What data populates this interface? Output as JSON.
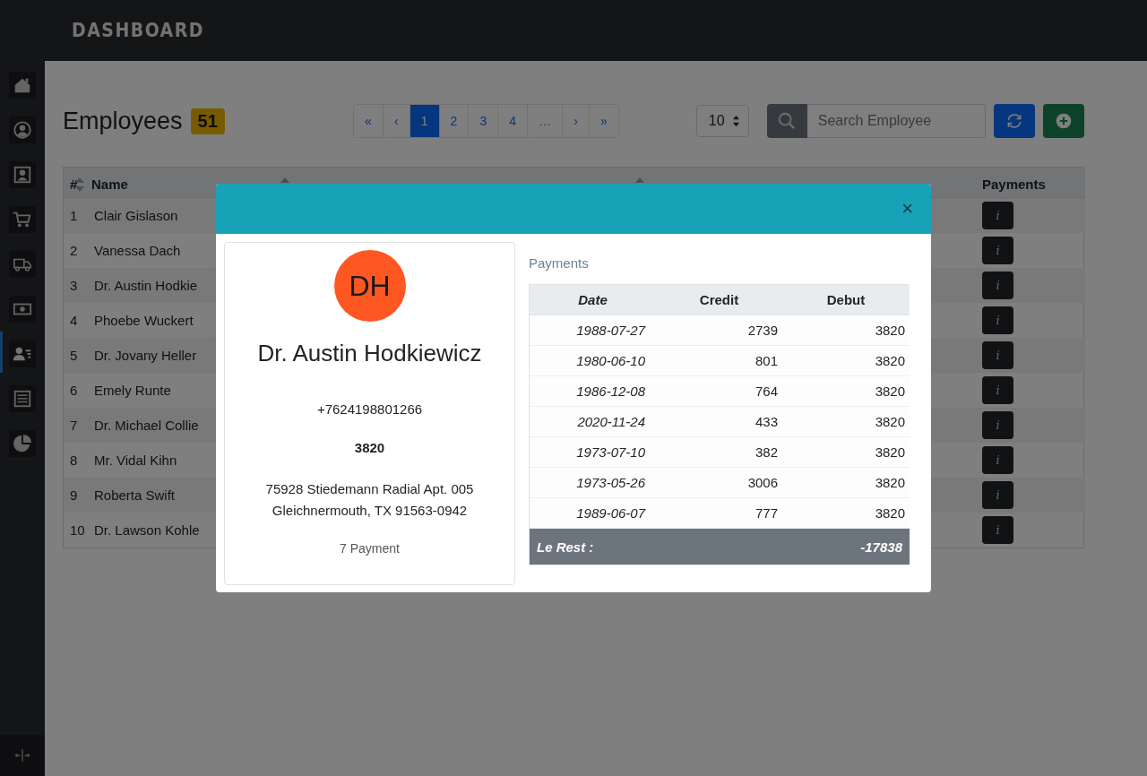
{
  "app": {
    "title": "DASHBOARD"
  },
  "sidebar": {
    "items": [
      {
        "selected": false
      },
      {
        "selected": false
      },
      {
        "selected": false
      },
      {
        "selected": false
      },
      {
        "selected": false
      },
      {
        "selected": false
      },
      {
        "selected": true
      },
      {
        "selected": false
      },
      {
        "selected": false
      }
    ]
  },
  "toolbar": {
    "heading": "Employees",
    "count": "51",
    "pagination": [
      {
        "label": "«",
        "selected": false
      },
      {
        "label": "‹",
        "selected": false
      },
      {
        "label": "1",
        "selected": true
      },
      {
        "label": "2",
        "selected": false
      },
      {
        "label": "3",
        "selected": false
      },
      {
        "label": "4",
        "selected": false
      },
      {
        "label": "…",
        "selected": false
      },
      {
        "label": "›",
        "selected": false
      },
      {
        "label": "»",
        "selected": false
      }
    ],
    "page_size": "10",
    "search": {
      "placeholder": "Search Employee"
    }
  },
  "table": {
    "columns": [
      {
        "label": "#",
        "sortable": false
      },
      {
        "label": "Name",
        "sortable": true
      },
      {
        "sortable": true
      },
      {
        "sortable": false
      },
      {
        "sortable": false
      },
      {
        "sortable": true
      },
      {
        "label": "Payments",
        "sortable": false
      }
    ],
    "rows": [
      {
        "number": "1",
        "name": "Clair Gislason",
        "button": "i"
      },
      {
        "number": "2",
        "name": "Vanessa Dach",
        "button": "i"
      },
      {
        "number": "3",
        "name": "Dr. Austin Hodkie",
        "button": "i"
      },
      {
        "number": "4",
        "name": "Phoebe Wuckert",
        "button": "i"
      },
      {
        "number": "5",
        "name": "Dr. Jovany Heller",
        "button": "i"
      },
      {
        "number": "6",
        "name": "Emely Runte",
        "button": "i"
      },
      {
        "number": "7",
        "name": "Dr. Michael Collie",
        "button": "i"
      },
      {
        "number": "8",
        "name": "Mr. Vidal Kihn",
        "button": "i"
      },
      {
        "number": "9",
        "name": "Roberta Swift",
        "button": "i"
      },
      {
        "number": "10",
        "name": "Dr. Lawson Kohle",
        "button": "i"
      }
    ]
  },
  "modal": {
    "close": "×",
    "initials": "DH",
    "name": "Dr. Austin Hodkiewicz",
    "phone": "+7624198801266",
    "salary": "3820",
    "address": [
      "75928 Stiedemann Radial Apt. 005",
      "Gleichnermouth, TX 91563-0942"
    ],
    "payment_count": "7 Payment",
    "payments": {
      "title": "Payments",
      "columns": [
        "Date",
        "Credit",
        "Debut"
      ],
      "rows": [
        {
          "date": "1988-07-27",
          "credit": "2739",
          "debut": "3820"
        },
        {
          "date": "1980-06-10",
          "credit": "801",
          "debut": "3820"
        },
        {
          "date": "1986-12-08",
          "credit": "764",
          "debut": "3820"
        },
        {
          "date": "2020-11-24",
          "credit": "433",
          "debut": "3820"
        },
        {
          "date": "1973-07-10",
          "credit": "382",
          "debut": "3820"
        },
        {
          "date": "1973-05-26",
          "credit": "3006",
          "debut": "3820"
        },
        {
          "date": "1989-06-07",
          "credit": "777",
          "debut": "3820"
        }
      ],
      "total_label": "Le Rest :",
      "total": "-17838"
    }
  }
}
